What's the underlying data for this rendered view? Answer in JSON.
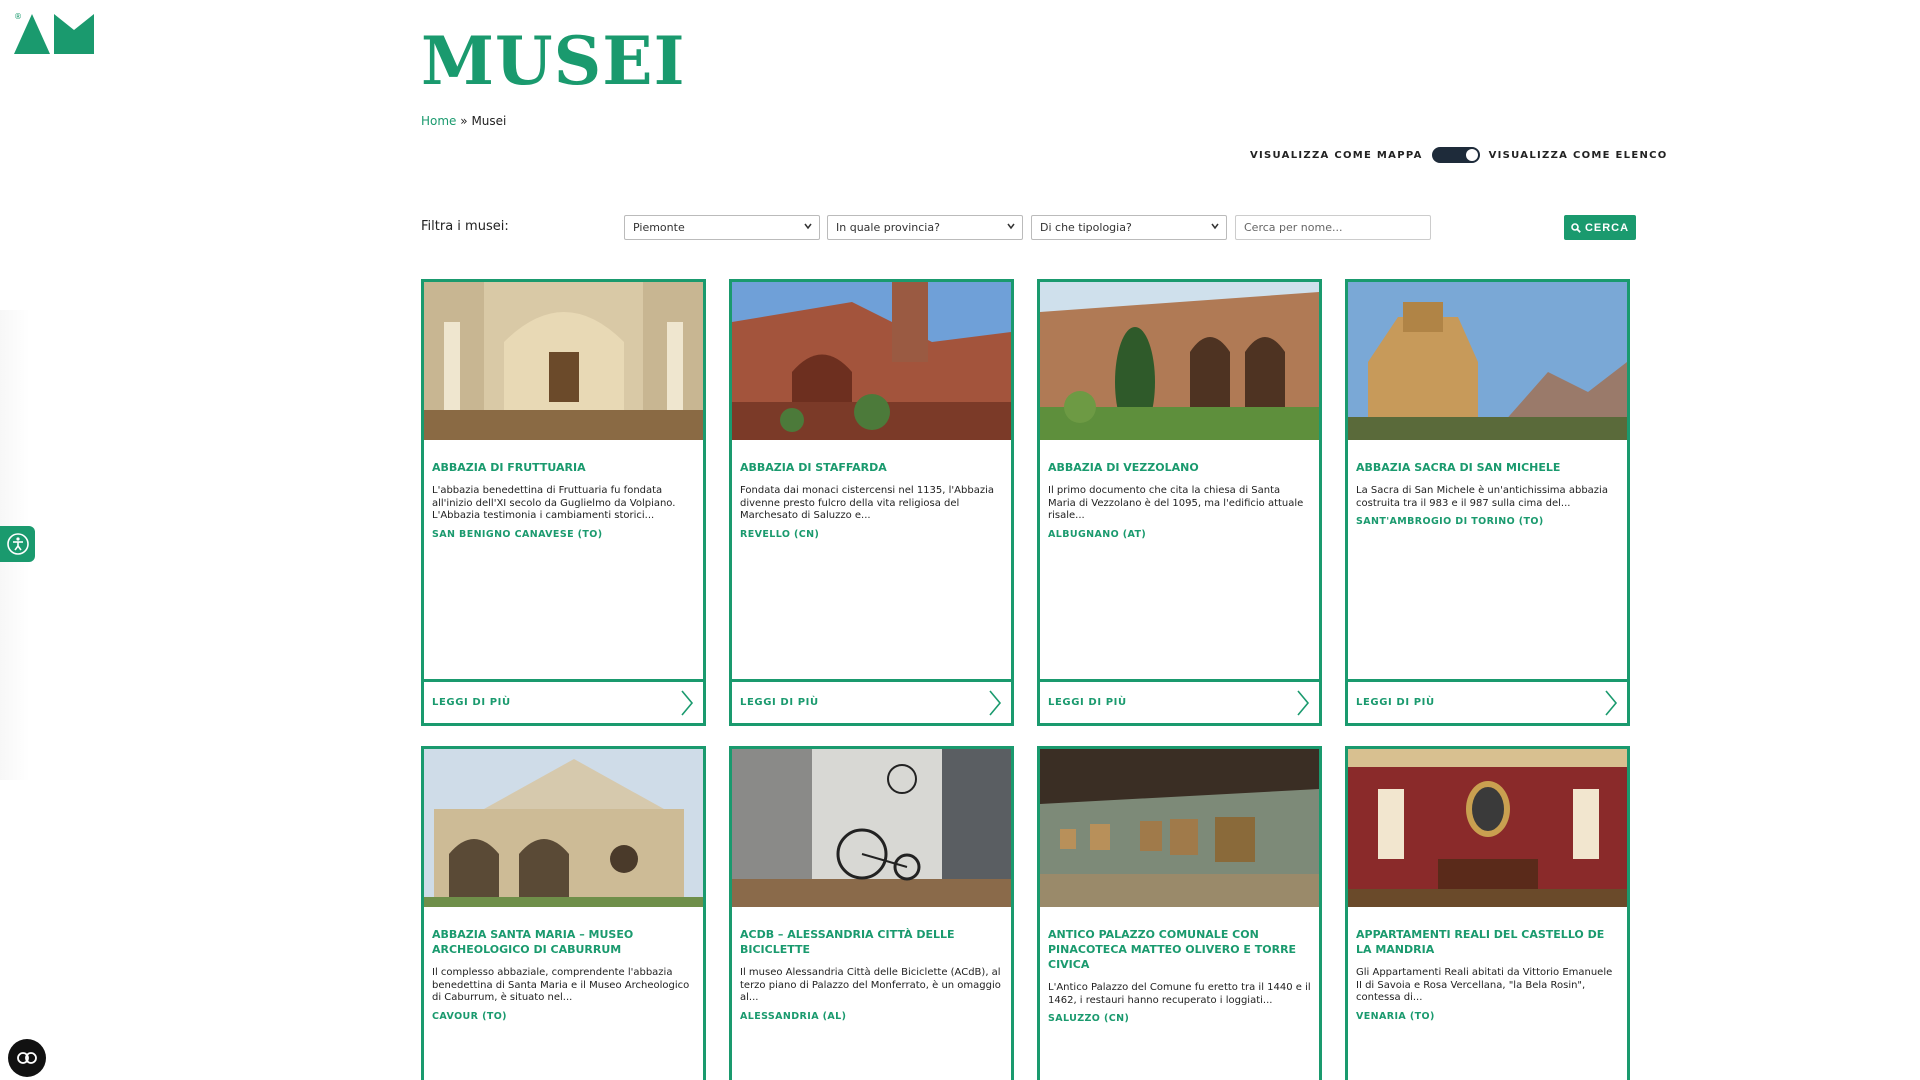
{
  "brand": {
    "logo_alt": "AM logo",
    "registered_mark": "®",
    "accent": "#1a9a6e"
  },
  "page_title": "MUSEI",
  "breadcrumb": {
    "home": "Home",
    "separator": "»",
    "current": "Musei"
  },
  "view_toggle": {
    "map_label": "VISUALIZZA COME MAPPA",
    "list_label": "VISUALIZZA COME ELENCO",
    "active": "list"
  },
  "filters": {
    "label": "Filtra i musei:",
    "region": "Piemonte",
    "province": "In quale provincia?",
    "type": "Di che tipologia?",
    "search_placeholder": "Cerca per nome...",
    "button": "CERCA"
  },
  "read_more_label": "LEGGI DI PIÙ",
  "cards": [
    {
      "name": "ABBAZIA DI FRUTTUARIA",
      "desc": "L'abbazia benedettina di Fruttuaria fu fondata all'inizio dell'XI secolo da Guglielmo da Volpiano. L'Abbazia testimonia i cambiamenti storici...",
      "location": "SAN BENIGNO CANAVESE (TO)",
      "image": "church-interior"
    },
    {
      "name": "ABBAZIA DI STAFFARDA",
      "desc": "Fondata dai monaci cistercensi nel 1135, l'Abbazia divenne presto fulcro della vita religiosa del Marchesato di Saluzzo e...",
      "location": "REVELLO (CN)",
      "image": "brick-abbey"
    },
    {
      "name": "ABBAZIA DI VEZZOLANO",
      "desc": "Il primo documento che cita la chiesa di Santa Maria di Vezzolano è del 1095, ma l'edificio attuale risale...",
      "location": "ALBUGNANO (AT)",
      "image": "cloister"
    },
    {
      "name": "ABBAZIA SACRA DI SAN MICHELE",
      "desc": "La Sacra di San Michele è un'antichissima abbazia costruita tra il 983 e il 987 sulla cima del...",
      "location": "SANT'AMBROGIO DI TORINO (TO)",
      "image": "mountain-abbey"
    },
    {
      "name": "ABBAZIA SANTA MARIA – MUSEO ARCHEOLOGICO DI CABURRUM",
      "desc": "Il complesso abbaziale, comprendente l'abbazia benedettina di Santa Maria e il Museo Archeologico di Caburrum, è situato nel...",
      "location": "CAVOUR (TO)",
      "image": "portico-church"
    },
    {
      "name": "ACDB – ALESSANDRIA CITTÀ DELLE BICICLETTE",
      "desc": "Il museo Alessandria Città delle Biciclette (ACdB), al terzo piano di Palazzo del Monferrato, è un omaggio al...",
      "location": "ALESSANDRIA (AL)",
      "image": "bicycles"
    },
    {
      "name": "ANTICO PALAZZO COMUNALE CON PINACOTECA MATTEO OLIVERO E TORRE CIVICA",
      "desc": "L'Antico Palazzo del Comune fu eretto tra il 1440 e il 1462, i restauri hanno recuperato i loggiati...",
      "location": "SALUZZO (CN)",
      "image": "gallery"
    },
    {
      "name": "APPARTAMENTI REALI DEL CASTELLO DE LA MANDRIA",
      "desc": "Gli Appartamenti Reali abitati da Vittorio Emanuele II di Savoia e Rosa Vercellana, \"la Bela Rosin\", contessa di...",
      "location": "VENARIA (TO)",
      "image": "royal-room"
    }
  ]
}
